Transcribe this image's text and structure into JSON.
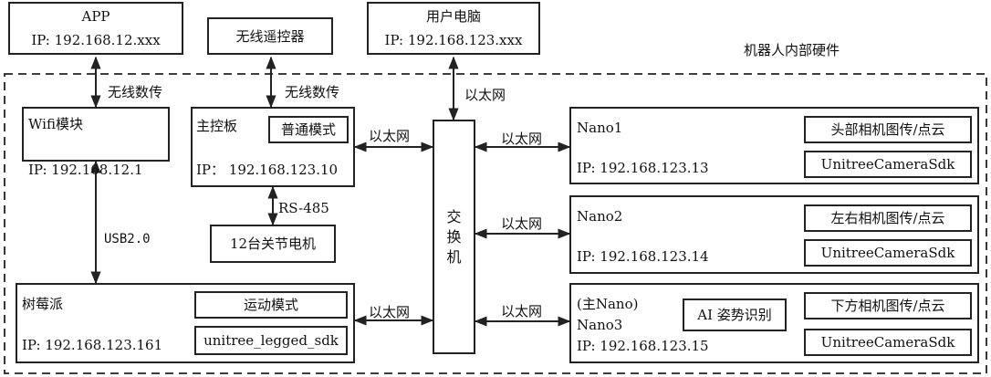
{
  "external": {
    "app": {
      "title": "APP",
      "ip": "IP: 192.168.12.xxx"
    },
    "remote": {
      "title": "无线遥控器"
    },
    "pc": {
      "title": "用户电脑",
      "ip": "IP: 192.168.123.xxx"
    }
  },
  "internal_label": "机器人内部硬件",
  "links": {
    "wireless1": "无线数传",
    "wireless2": "无线数传",
    "ethernet_pc": "以太网",
    "ethernet_main": "以太网",
    "ethernet_pi": "以太网",
    "ethernet_nano1": "以太网",
    "ethernet_nano2": "以太网",
    "ethernet_nano3": "以太网",
    "rs485": "RS-485",
    "usb": "USB2.0"
  },
  "wifi": {
    "title": "Wifi模块",
    "ip": "IP: 192.168.12.1"
  },
  "mainboard": {
    "title": "主控板",
    "mode": "普通模式",
    "ip": "IP：  192.168.123.10"
  },
  "motors": {
    "title": "12台关节电机"
  },
  "pi": {
    "title": "树莓派",
    "mode": "运动模式",
    "sdk": "unitree_legged_sdk",
    "ip": "IP: 192.168.123.161"
  },
  "switch": {
    "chars": [
      "交",
      "换",
      "机"
    ]
  },
  "nano1": {
    "title": "Nano1",
    "ip": "IP: 192.168.123.13",
    "func": "头部相机图传/点云",
    "sdk": "UnitreeCameraSdk"
  },
  "nano2": {
    "title": "Nano2",
    "ip": "IP: 192.168.123.14",
    "func": "左右相机图传/点云",
    "sdk": "UnitreeCameraSdk"
  },
  "nano3": {
    "main_tag": "(主Nano)",
    "title": "Nano3",
    "ip": "IP: 192.168.123.15",
    "ai": "AI 姿势识别",
    "func": "下方相机图传/点云",
    "sdk": "UnitreeCameraSdk"
  }
}
